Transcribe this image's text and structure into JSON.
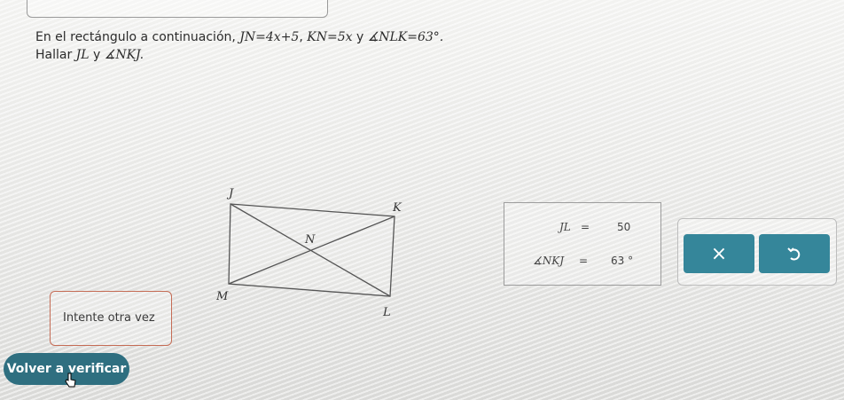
{
  "problem": {
    "line1_text": "En el rectángulo a continuación, ",
    "line1_given1": "JN=4x+5",
    "line1_sep1": ", ",
    "line1_given2": "KN=5x",
    "line1_sep2": " y ",
    "line1_given3": "∡NLK=63°.",
    "line2_text": "Hallar ",
    "line2_var1": "JL",
    "line2_sep": " y ",
    "line2_var2": "∡NKJ."
  },
  "diagram": {
    "labels": {
      "J": "J",
      "K": "K",
      "M": "M",
      "L": "L",
      "N": "N"
    }
  },
  "answers": {
    "jl_label": "JL",
    "jl_eq": "=",
    "jl_value": "50",
    "angle_label": "∡NKJ",
    "angle_eq": "=",
    "angle_value": "63",
    "angle_unit": "°"
  },
  "buttons": {
    "clear_symbol": "×",
    "check_label": "Volver a verificar"
  },
  "feedback": {
    "message": "Intente otra vez"
  },
  "colors": {
    "button_teal": "#35869a",
    "check_button": "#2f6f80",
    "feedback_border": "#c56c55"
  },
  "icons": {
    "clear": "x-icon",
    "undo": "undo-icon",
    "cursor": "hand-pointer-icon"
  }
}
